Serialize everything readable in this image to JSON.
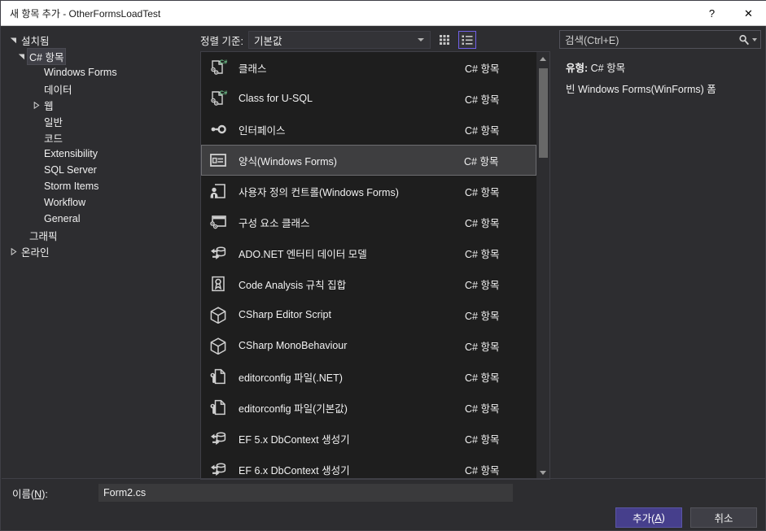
{
  "window": {
    "title": "새 항목 추가 - OtherFormsLoadTest",
    "help_glyph": "?",
    "close_glyph": "✕"
  },
  "tree": {
    "items": [
      {
        "label": "설치됨",
        "level": 0,
        "arrow": "expanded",
        "selected": false
      },
      {
        "label": "C# 항목",
        "level": 1,
        "arrow": "expanded",
        "selected": true
      },
      {
        "label": "Windows Forms",
        "level": 2,
        "arrow": "none",
        "selected": false
      },
      {
        "label": "데이터",
        "level": 2,
        "arrow": "none",
        "selected": false
      },
      {
        "label": "웹",
        "level": 2,
        "arrow": "collapsed",
        "selected": false
      },
      {
        "label": "일반",
        "level": 2,
        "arrow": "none",
        "selected": false
      },
      {
        "label": "코드",
        "level": 2,
        "arrow": "none",
        "selected": false
      },
      {
        "label": "Extensibility",
        "level": 2,
        "arrow": "none",
        "selected": false
      },
      {
        "label": "SQL Server",
        "level": 2,
        "arrow": "none",
        "selected": false
      },
      {
        "label": "Storm Items",
        "level": 2,
        "arrow": "none",
        "selected": false
      },
      {
        "label": "Workflow",
        "level": 2,
        "arrow": "none",
        "selected": false
      },
      {
        "label": "General",
        "level": 2,
        "arrow": "none",
        "selected": false
      },
      {
        "label": "그래픽",
        "level": 1,
        "arrow": "none",
        "selected": false
      },
      {
        "label": "온라인",
        "level": 0,
        "arrow": "collapsed",
        "selected": false
      }
    ]
  },
  "toolbar": {
    "sort_label": "정렬 기준:",
    "sort_value": "기본값",
    "sort_options": [
      "기본값"
    ],
    "view_tiles_name": "tiles-view",
    "view_list_name": "list-view",
    "active_view": "list"
  },
  "search": {
    "placeholder": "검색(Ctrl+E)",
    "value": "검색(Ctrl+E)"
  },
  "list": {
    "kind_label": "C# 항목",
    "selected_index": 3,
    "items": [
      {
        "name": "클래스",
        "kind": "C# 항목",
        "icon": "csharp-class-icon"
      },
      {
        "name": "Class for U-SQL",
        "kind": "C# 항목",
        "icon": "csharp-class-icon"
      },
      {
        "name": "인터페이스",
        "kind": "C# 항목",
        "icon": "interface-icon"
      },
      {
        "name": "양식(Windows Forms)",
        "kind": "C# 항목",
        "icon": "winform-icon"
      },
      {
        "name": "사용자 정의 컨트롤(Windows Forms)",
        "kind": "C# 항목",
        "icon": "usercontrol-icon"
      },
      {
        "name": "구성 요소 클래스",
        "kind": "C# 항목",
        "icon": "component-class-icon"
      },
      {
        "name": "ADO.NET 엔터티 데이터 모델",
        "kind": "C# 항목",
        "icon": "entity-model-icon"
      },
      {
        "name": "Code Analysis 규칙 집합",
        "kind": "C# 항목",
        "icon": "ruleset-icon"
      },
      {
        "name": "CSharp Editor Script",
        "kind": "C# 항목",
        "icon": "cube-icon"
      },
      {
        "name": "CSharp MonoBehaviour",
        "kind": "C# 항목",
        "icon": "cube-icon"
      },
      {
        "name": "editorconfig 파일(.NET)",
        "kind": "C# 항목",
        "icon": "editorconfig-icon"
      },
      {
        "name": "editorconfig 파일(기본값)",
        "kind": "C# 항목",
        "icon": "editorconfig-icon"
      },
      {
        "name": "EF 5.x DbContext 생성기",
        "kind": "C# 항목",
        "icon": "entity-model-icon"
      },
      {
        "name": "EF 6.x DbContext 생성기",
        "kind": "C# 항목",
        "icon": "entity-model-icon"
      }
    ]
  },
  "description": {
    "type_label": "유형:",
    "type_value": "C# 항목",
    "body": "빈 Windows Forms(WinForms) 폼"
  },
  "name_field": {
    "label_text": "이름(N):",
    "label_prefix": "이름(",
    "label_mnemonic": "N",
    "label_suffix": "):",
    "value": "Form2.cs"
  },
  "footer": {
    "add_prefix": "추가(",
    "add_mnemonic": "A",
    "add_suffix": ")",
    "add_label": "추가(A)",
    "cancel_label": "취소"
  },
  "colors": {
    "dialog_bg": "#2d2d30",
    "list_bg": "#1e1e1e",
    "titlebar_bg": "#ffffff",
    "accent": "#463f8c",
    "selection": "#3e3e40",
    "view_active_border": "#7160e8",
    "csharp_green": "#73c991"
  }
}
